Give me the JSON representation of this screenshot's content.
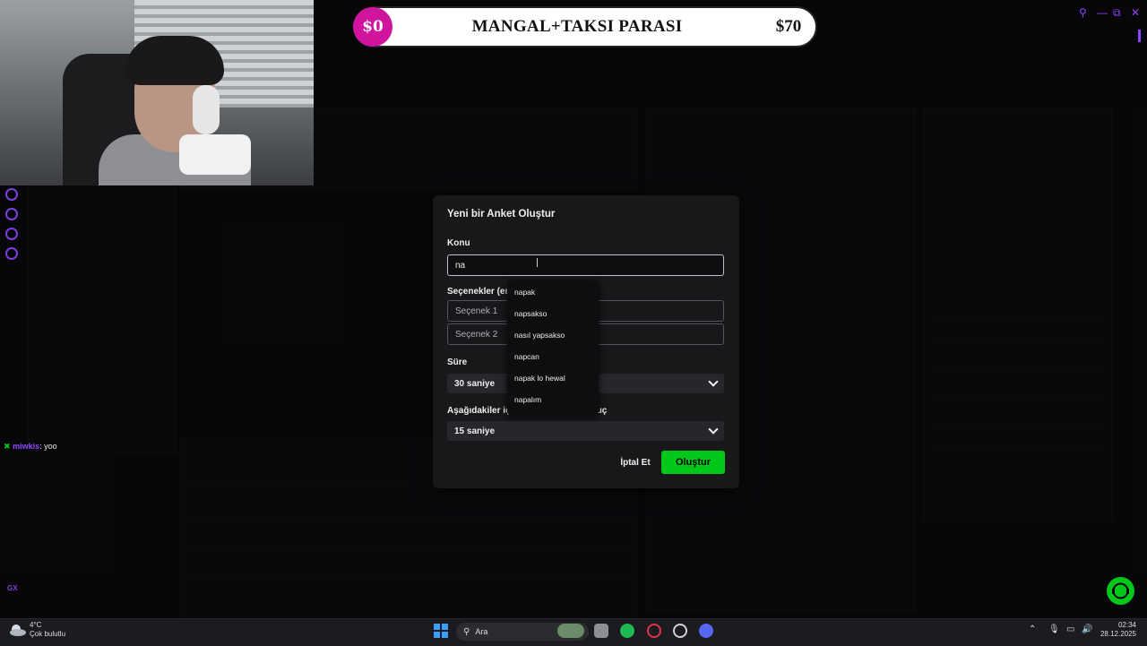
{
  "donation_goal": {
    "start_amount": "$0",
    "title": "MANGAL+TAKSI PARASI",
    "goal_amount": "$70"
  },
  "left_chat": {
    "username": "miwkis",
    "message": ": yoo"
  },
  "left_rail_label": "GX",
  "modal": {
    "title": "Yeni bir Anket Oluştur",
    "topic_label": "Konu",
    "topic_value": "na",
    "options_label": "Seçenekler (en",
    "option1_placeholder": "Seçenek 1",
    "option2_placeholder": "Seçenek 2",
    "duration_label": "Süre",
    "duration_value": "30 saniye",
    "result_label": "Aşağıdakiler için görüntülenen sonuç",
    "result_value": "15 saniye",
    "cancel_label": "İptal Et",
    "create_label": "Oluştur"
  },
  "autocomplete": [
    "napak",
    "napsakso",
    "nasıl yapsakso",
    "napcan",
    "napak lo hewal",
    "napalım"
  ],
  "taskbar": {
    "search_placeholder": "Ara",
    "temperature": "4°C",
    "weather": "Çok bulutlu",
    "time": "02:34",
    "date": "28.12.2025"
  },
  "colors": {
    "accent": "#9146ff",
    "create_button": "#00c819",
    "donation_circle": "#d0149e"
  },
  "icons": [
    "search-icon",
    "minimize-icon",
    "restore-icon",
    "close-icon",
    "chevron-down-icon",
    "windows-start-icon",
    "spotify-icon",
    "opera-gx-icon",
    "discord-icon",
    "wifi-icon",
    "volume-icon",
    "chat-float-icon"
  ]
}
